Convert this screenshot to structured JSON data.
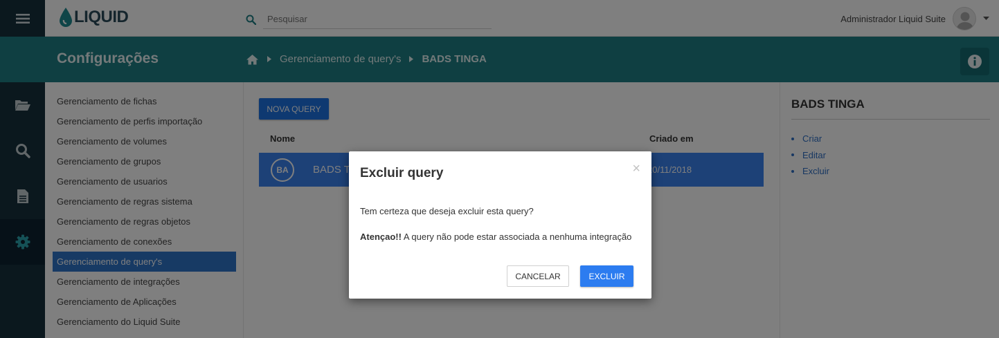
{
  "topbar": {
    "logo_text": "LIQUID",
    "search_placeholder": "Pesquisar",
    "user_name": "Administrador Liquid Suite"
  },
  "header": {
    "title": "Configurações",
    "breadcrumb": [
      "Gerenciamento de query's",
      "BADS TINGA"
    ]
  },
  "rail": {
    "icons": [
      "menu-icon",
      "folder-open-icon",
      "search-icon",
      "document-icon",
      "gear-icon"
    ]
  },
  "sidebar": {
    "items": [
      {
        "label": "Gerenciamento de fichas"
      },
      {
        "label": "Gerenciamento de perfis importação"
      },
      {
        "label": "Gerenciamento de volumes"
      },
      {
        "label": "Gerenciamento de grupos"
      },
      {
        "label": "Gerenciamento de usuarios"
      },
      {
        "label": "Gerenciamento de regras sistema"
      },
      {
        "label": "Gerenciamento de regras objetos"
      },
      {
        "label": "Gerenciamento de conexões"
      },
      {
        "label": "Gerenciamento de query's",
        "active": true
      },
      {
        "label": "Gerenciamento de integrações"
      },
      {
        "label": "Gerenciamento de Aplicações"
      },
      {
        "label": "Gerenciamento do Liquid Suite"
      }
    ]
  },
  "main": {
    "new_button": "NOVA QUERY",
    "columns": [
      "Nome",
      "Criado em"
    ],
    "rows": [
      {
        "badge": "BA",
        "name": "BADS TINGA",
        "created": "20/11/2018"
      }
    ]
  },
  "right_panel": {
    "title": "BADS TINGA",
    "actions": [
      "Criar",
      "Editar",
      "Excluir"
    ]
  },
  "modal": {
    "title": "Excluir query",
    "close": "×",
    "message": "Tem certeza que deseja excluir esta query?",
    "warning_label": "Atençao!!",
    "warning_text": " A query não pode estar associada a nenhuma integração",
    "cancel": "CANCELAR",
    "confirm": "EXCLUIR"
  },
  "colors": {
    "teal": "#1e7f85",
    "navy": "#16303d",
    "primary": "#2c7cf0"
  }
}
